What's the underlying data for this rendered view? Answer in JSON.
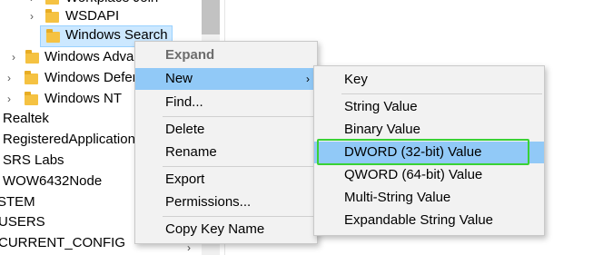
{
  "tree": {
    "items": [
      {
        "label": "Workplace Join",
        "expander": "›"
      },
      {
        "label": "WSDAPI",
        "expander": "›"
      },
      {
        "label": "Windows Search",
        "expander": ""
      },
      {
        "label": "Windows Advanced Installer",
        "expander": "›"
      },
      {
        "label": "Windows Defender",
        "expander": "›"
      },
      {
        "label": "Windows NT",
        "expander": "›"
      },
      {
        "label": "Realtek"
      },
      {
        "label": "RegisteredApplications"
      },
      {
        "label": "SRS Labs"
      },
      {
        "label": "WOW6432Node"
      },
      {
        "label": "STEM"
      },
      {
        "label": "USERS"
      },
      {
        "label": "CURRENT_CONFIG"
      }
    ]
  },
  "context_menu": {
    "items": [
      "Expand",
      "New",
      "Find...",
      "Delete",
      "Rename",
      "Export",
      "Permissions...",
      "Copy Key Name"
    ],
    "submenu_arrow": "›"
  },
  "new_submenu": {
    "items": [
      "Key",
      "String Value",
      "Binary Value",
      "DWORD (32-bit) Value",
      "QWORD (64-bit) Value",
      "Multi-String Value",
      "Expandable String Value"
    ]
  },
  "scroll": {
    "down_arrow": "›"
  },
  "colors": {
    "highlight": "#91c9f7",
    "selection": "#cce8ff",
    "annotation": "#3ad235"
  }
}
